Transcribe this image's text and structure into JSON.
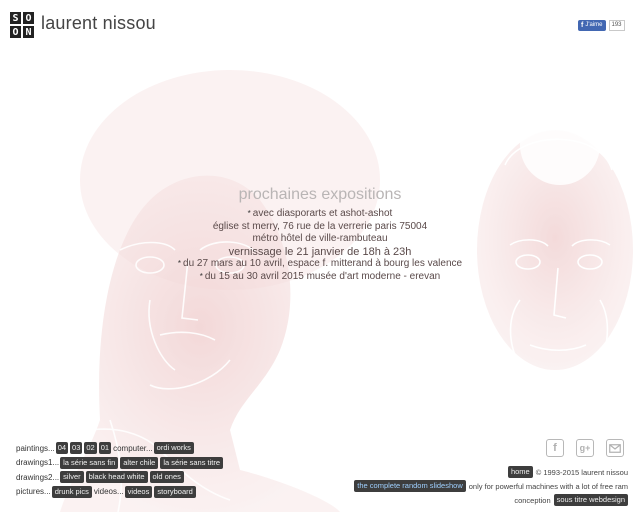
{
  "header": {
    "logo_letters": [
      "S",
      "O",
      "O",
      "N"
    ],
    "site_name": "laurent nissou",
    "fb_like_label": "J'aime",
    "fb_like_count": "193"
  },
  "exhibitions": {
    "title": "prochaines expositions",
    "lines": [
      "avec diasporarts et ashot-ashot",
      "église st merry, 76 rue de la verrerie paris 75004",
      "métro hôtel de ville-rambuteau",
      "vernissage le 21 janvier de 18h à 23h",
      "du 27 mars au 10 avril, espace f. mitterand à bourg les valence",
      "du 15 au 30 avril 2015 musée d'art moderne - erevan"
    ]
  },
  "nav": {
    "paintings_label": "paintings...",
    "paintings_items": [
      "04",
      "03",
      "02",
      "01"
    ],
    "computer_label": "computer...",
    "computer_items": [
      "ordi works"
    ],
    "drawings1_label": "drawings1...",
    "drawings1_items": [
      "la série sans fin",
      "alter chile",
      "la série sans titre"
    ],
    "drawings2_label": "drawings2...",
    "drawings2_items": [
      "silver",
      "black head white",
      "old ones"
    ],
    "pictures_label": "pictures...",
    "pictures_items": [
      "drunk pics"
    ],
    "videos_label": "videos...",
    "videos_items": [
      "videos",
      "storyboard"
    ]
  },
  "social": {
    "icons": [
      "facebook-icon",
      "google-plus-icon",
      "email-icon"
    ]
  },
  "footer": {
    "home_label": "home",
    "copyright": "© 1993-2015 laurent nissou",
    "slideshow_label": "the complete random slideshow",
    "slideshow_note": "only for powerful machines with a lot of free ram",
    "conception_label": "conception",
    "conception_link": "sous titre webdesign"
  },
  "colors": {
    "art_red": "#d98b8b",
    "chip_bg": "#3d3d3d",
    "fb_blue": "#4267b2"
  }
}
